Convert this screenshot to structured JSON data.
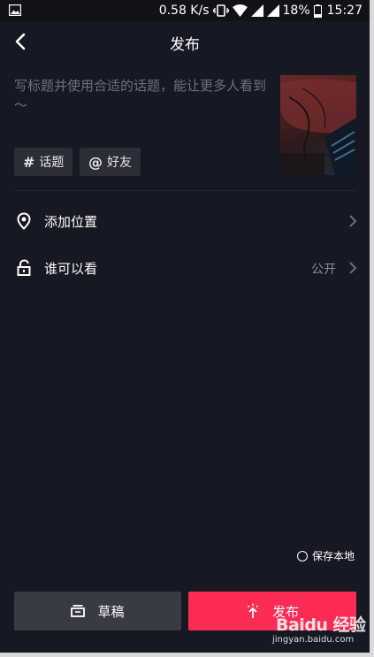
{
  "status_bar": {
    "speed": "0.58 K/s",
    "battery": "18%",
    "time": "15:27"
  },
  "nav": {
    "title": "发布"
  },
  "caption": {
    "placeholder": "写标题并使用合适的话题，能让更多人看到～"
  },
  "chips": [
    {
      "symbol": "#",
      "label": "话题"
    },
    {
      "symbol": "@",
      "label": "好友"
    }
  ],
  "rows": [
    {
      "label": "添加位置",
      "value": ""
    },
    {
      "label": "谁可以看",
      "value": "公开"
    }
  ],
  "save_local": {
    "label": "保存本地"
  },
  "buttons": {
    "draft": "草稿",
    "publish": "发布"
  },
  "watermark": {
    "brand": "Baidu 经验",
    "url": "jingyan.baidu.com"
  },
  "colors": {
    "background": "#161823",
    "accent": "#fe2c55",
    "draft_button": "#383a44",
    "chip": "#2b2d37"
  }
}
